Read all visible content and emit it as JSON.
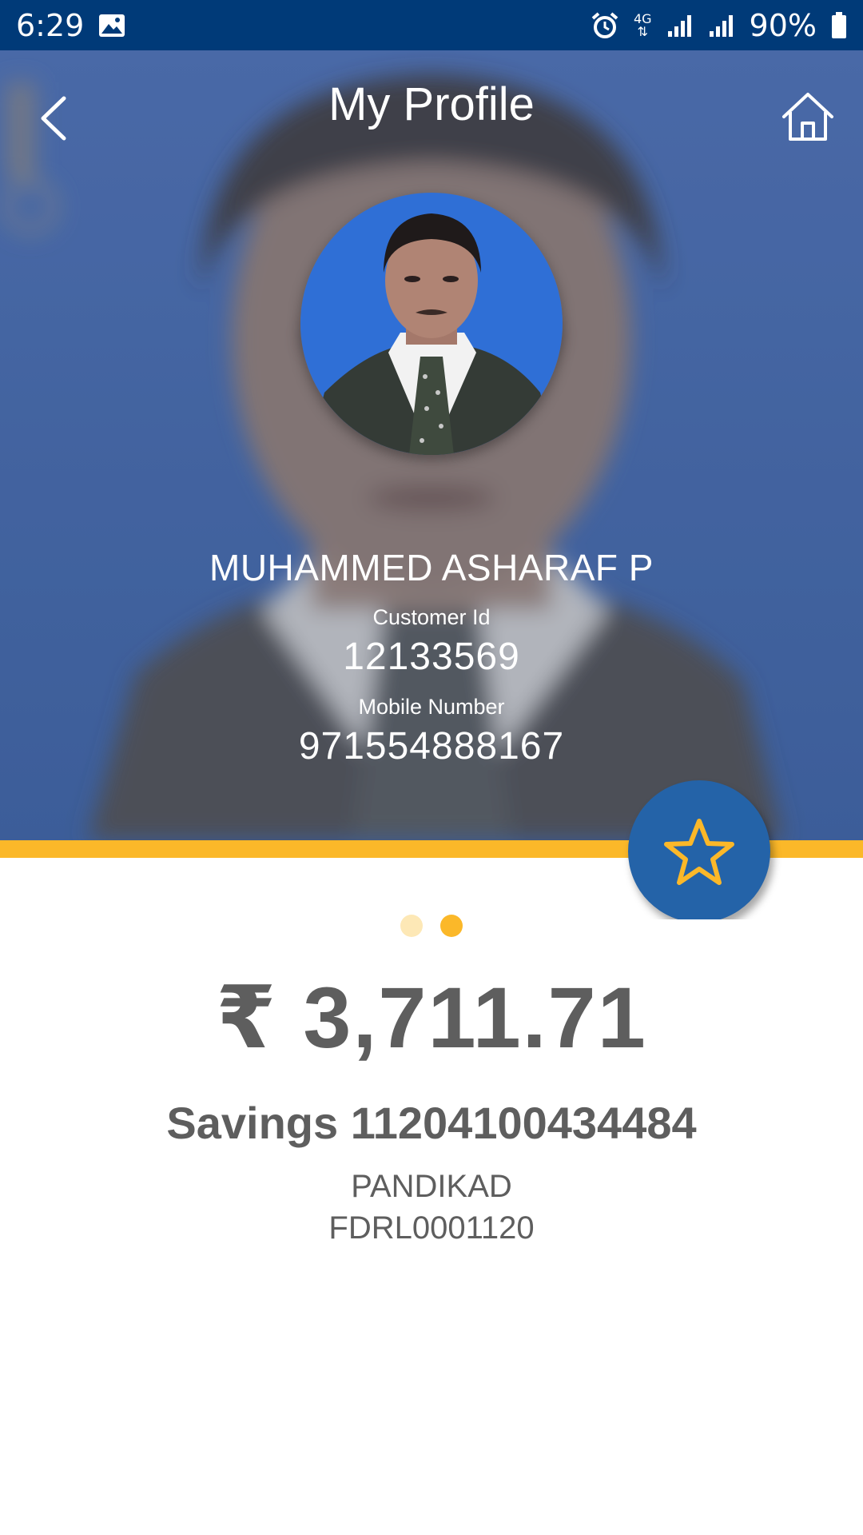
{
  "status_bar": {
    "time": "6:29",
    "network": "4G",
    "battery": "90%",
    "icons": [
      "gallery-icon",
      "alarm-icon",
      "data-arrows-icon",
      "signal-icon",
      "signal-icon",
      "battery-icon"
    ]
  },
  "header": {
    "title": "My Profile",
    "back_icon": "back-chevron-icon",
    "home_icon": "home-icon"
  },
  "profile": {
    "name": "MUHAMMED ASHARAF P",
    "customer_id_label": "Customer Id",
    "customer_id": "12133569",
    "mobile_label": "Mobile Number",
    "mobile_number": "971554888167"
  },
  "favorite_button": {
    "icon": "star-outline-icon"
  },
  "account_carousel": {
    "page_count": 2,
    "active_index": 1,
    "balance": "₹ 3,711.71",
    "account_label": "Savings 11204100434484",
    "branch": "PANDIKAD",
    "ifsc": "FDRL0001120"
  },
  "colors": {
    "status_bar": "#003a78",
    "hero_blue": "#3c63a4",
    "accent_yellow": "#fbb829",
    "fab_blue": "#2463a8",
    "text_gray": "#5e5e5e",
    "dot_inactive": "#fde8b6"
  }
}
